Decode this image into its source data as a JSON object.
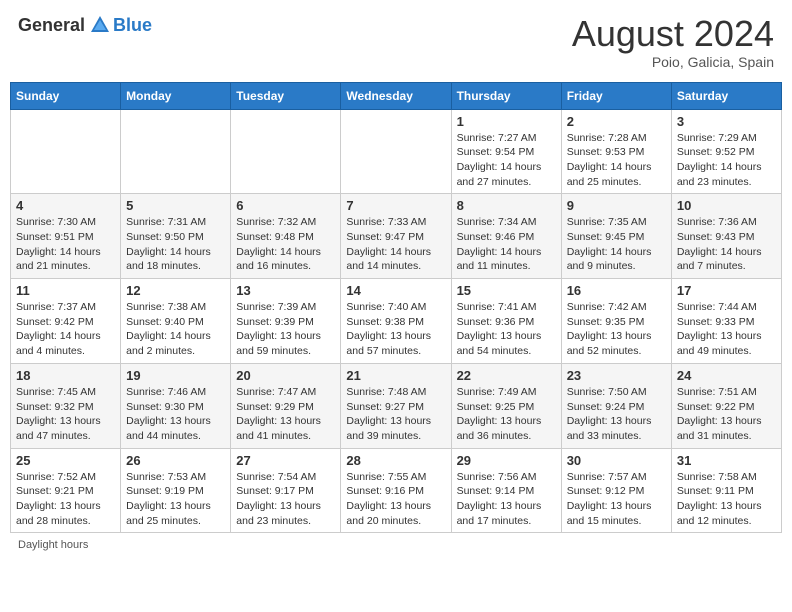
{
  "header": {
    "logo_general": "General",
    "logo_blue": "Blue",
    "month_year": "August 2024",
    "location": "Poio, Galicia, Spain"
  },
  "days_of_week": [
    "Sunday",
    "Monday",
    "Tuesday",
    "Wednesday",
    "Thursday",
    "Friday",
    "Saturday"
  ],
  "weeks": [
    [
      {
        "day": "",
        "info": ""
      },
      {
        "day": "",
        "info": ""
      },
      {
        "day": "",
        "info": ""
      },
      {
        "day": "",
        "info": ""
      },
      {
        "day": "1",
        "info": "Sunrise: 7:27 AM\nSunset: 9:54 PM\nDaylight: 14 hours and 27 minutes."
      },
      {
        "day": "2",
        "info": "Sunrise: 7:28 AM\nSunset: 9:53 PM\nDaylight: 14 hours and 25 minutes."
      },
      {
        "day": "3",
        "info": "Sunrise: 7:29 AM\nSunset: 9:52 PM\nDaylight: 14 hours and 23 minutes."
      }
    ],
    [
      {
        "day": "4",
        "info": "Sunrise: 7:30 AM\nSunset: 9:51 PM\nDaylight: 14 hours and 21 minutes."
      },
      {
        "day": "5",
        "info": "Sunrise: 7:31 AM\nSunset: 9:50 PM\nDaylight: 14 hours and 18 minutes."
      },
      {
        "day": "6",
        "info": "Sunrise: 7:32 AM\nSunset: 9:48 PM\nDaylight: 14 hours and 16 minutes."
      },
      {
        "day": "7",
        "info": "Sunrise: 7:33 AM\nSunset: 9:47 PM\nDaylight: 14 hours and 14 minutes."
      },
      {
        "day": "8",
        "info": "Sunrise: 7:34 AM\nSunset: 9:46 PM\nDaylight: 14 hours and 11 minutes."
      },
      {
        "day": "9",
        "info": "Sunrise: 7:35 AM\nSunset: 9:45 PM\nDaylight: 14 hours and 9 minutes."
      },
      {
        "day": "10",
        "info": "Sunrise: 7:36 AM\nSunset: 9:43 PM\nDaylight: 14 hours and 7 minutes."
      }
    ],
    [
      {
        "day": "11",
        "info": "Sunrise: 7:37 AM\nSunset: 9:42 PM\nDaylight: 14 hours and 4 minutes."
      },
      {
        "day": "12",
        "info": "Sunrise: 7:38 AM\nSunset: 9:40 PM\nDaylight: 14 hours and 2 minutes."
      },
      {
        "day": "13",
        "info": "Sunrise: 7:39 AM\nSunset: 9:39 PM\nDaylight: 13 hours and 59 minutes."
      },
      {
        "day": "14",
        "info": "Sunrise: 7:40 AM\nSunset: 9:38 PM\nDaylight: 13 hours and 57 minutes."
      },
      {
        "day": "15",
        "info": "Sunrise: 7:41 AM\nSunset: 9:36 PM\nDaylight: 13 hours and 54 minutes."
      },
      {
        "day": "16",
        "info": "Sunrise: 7:42 AM\nSunset: 9:35 PM\nDaylight: 13 hours and 52 minutes."
      },
      {
        "day": "17",
        "info": "Sunrise: 7:44 AM\nSunset: 9:33 PM\nDaylight: 13 hours and 49 minutes."
      }
    ],
    [
      {
        "day": "18",
        "info": "Sunrise: 7:45 AM\nSunset: 9:32 PM\nDaylight: 13 hours and 47 minutes."
      },
      {
        "day": "19",
        "info": "Sunrise: 7:46 AM\nSunset: 9:30 PM\nDaylight: 13 hours and 44 minutes."
      },
      {
        "day": "20",
        "info": "Sunrise: 7:47 AM\nSunset: 9:29 PM\nDaylight: 13 hours and 41 minutes."
      },
      {
        "day": "21",
        "info": "Sunrise: 7:48 AM\nSunset: 9:27 PM\nDaylight: 13 hours and 39 minutes."
      },
      {
        "day": "22",
        "info": "Sunrise: 7:49 AM\nSunset: 9:25 PM\nDaylight: 13 hours and 36 minutes."
      },
      {
        "day": "23",
        "info": "Sunrise: 7:50 AM\nSunset: 9:24 PM\nDaylight: 13 hours and 33 minutes."
      },
      {
        "day": "24",
        "info": "Sunrise: 7:51 AM\nSunset: 9:22 PM\nDaylight: 13 hours and 31 minutes."
      }
    ],
    [
      {
        "day": "25",
        "info": "Sunrise: 7:52 AM\nSunset: 9:21 PM\nDaylight: 13 hours and 28 minutes."
      },
      {
        "day": "26",
        "info": "Sunrise: 7:53 AM\nSunset: 9:19 PM\nDaylight: 13 hours and 25 minutes."
      },
      {
        "day": "27",
        "info": "Sunrise: 7:54 AM\nSunset: 9:17 PM\nDaylight: 13 hours and 23 minutes."
      },
      {
        "day": "28",
        "info": "Sunrise: 7:55 AM\nSunset: 9:16 PM\nDaylight: 13 hours and 20 minutes."
      },
      {
        "day": "29",
        "info": "Sunrise: 7:56 AM\nSunset: 9:14 PM\nDaylight: 13 hours and 17 minutes."
      },
      {
        "day": "30",
        "info": "Sunrise: 7:57 AM\nSunset: 9:12 PM\nDaylight: 13 hours and 15 minutes."
      },
      {
        "day": "31",
        "info": "Sunrise: 7:58 AM\nSunset: 9:11 PM\nDaylight: 13 hours and 12 minutes."
      }
    ]
  ],
  "footer": {
    "label": "Daylight hours"
  }
}
